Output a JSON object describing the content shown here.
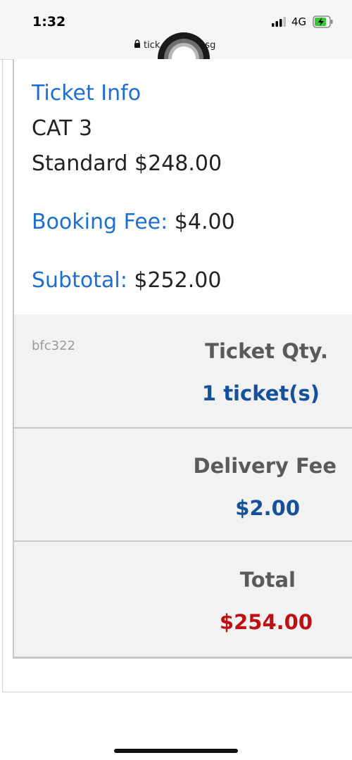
{
  "status_bar": {
    "time": "1:32",
    "network": "4G",
    "url_left": "tick",
    "url_right": "sg"
  },
  "ticket_info": {
    "heading": "Ticket Info",
    "category": "CAT 3",
    "price_line": "Standard $248.00",
    "booking_fee_label": "Booking Fee:",
    "booking_fee_value": "$4.00",
    "subtotal_label": "Subtotal:",
    "subtotal_value": "$252.00"
  },
  "summary": {
    "ref_code": "bfc322",
    "qty_label": "Ticket Qty.",
    "qty_value": "1 ticket(s)",
    "delivery_label": "Delivery Fee",
    "delivery_value": "$2.00",
    "total_label": "Total",
    "total_value": "$254.00"
  },
  "colors": {
    "link_blue": "#1c6fd1",
    "value_blue": "#14509c",
    "total_red": "#c00f12"
  }
}
